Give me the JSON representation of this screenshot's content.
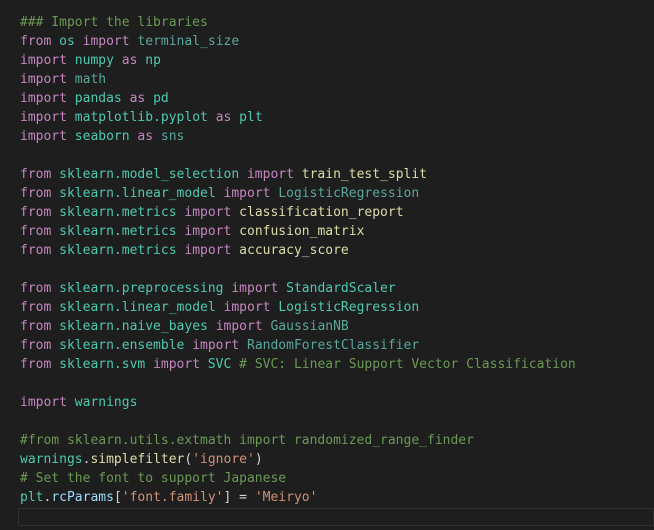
{
  "colors": {
    "background": "#1e1e1e",
    "keyword": "#c586c0",
    "module": "#4ec9b0",
    "dim_module": "#58a89b",
    "function": "#dcdcaa",
    "string": "#ce9178",
    "comment": "#6a9955",
    "variable": "#9cdcfe",
    "text": "#d4d4d4"
  },
  "lines": [
    [
      {
        "t": "### Import the libraries",
        "k": "comment"
      }
    ],
    [
      {
        "t": "from",
        "k": "keyword"
      },
      {
        "t": " ",
        "k": "plain"
      },
      {
        "t": "os",
        "k": "module"
      },
      {
        "t": " ",
        "k": "plain"
      },
      {
        "t": "import",
        "k": "keyword"
      },
      {
        "t": " ",
        "k": "plain"
      },
      {
        "t": "terminal_size",
        "k": "dim"
      }
    ],
    [
      {
        "t": "import",
        "k": "keyword"
      },
      {
        "t": " ",
        "k": "plain"
      },
      {
        "t": "numpy",
        "k": "module"
      },
      {
        "t": " ",
        "k": "plain"
      },
      {
        "t": "as",
        "k": "keyword"
      },
      {
        "t": " ",
        "k": "plain"
      },
      {
        "t": "np",
        "k": "module"
      }
    ],
    [
      {
        "t": "import",
        "k": "keyword"
      },
      {
        "t": " ",
        "k": "plain"
      },
      {
        "t": "math",
        "k": "dim"
      }
    ],
    [
      {
        "t": "import",
        "k": "keyword"
      },
      {
        "t": " ",
        "k": "plain"
      },
      {
        "t": "pandas",
        "k": "module"
      },
      {
        "t": " ",
        "k": "plain"
      },
      {
        "t": "as",
        "k": "keyword"
      },
      {
        "t": " ",
        "k": "plain"
      },
      {
        "t": "pd",
        "k": "module"
      }
    ],
    [
      {
        "t": "import",
        "k": "keyword"
      },
      {
        "t": " ",
        "k": "plain"
      },
      {
        "t": "matplotlib.pyplot",
        "k": "module"
      },
      {
        "t": " ",
        "k": "plain"
      },
      {
        "t": "as",
        "k": "keyword"
      },
      {
        "t": " ",
        "k": "plain"
      },
      {
        "t": "plt",
        "k": "module"
      }
    ],
    [
      {
        "t": "import",
        "k": "keyword"
      },
      {
        "t": " ",
        "k": "plain"
      },
      {
        "t": "seaborn",
        "k": "module"
      },
      {
        "t": " ",
        "k": "plain"
      },
      {
        "t": "as",
        "k": "keyword"
      },
      {
        "t": " ",
        "k": "plain"
      },
      {
        "t": "sns",
        "k": "dim"
      }
    ],
    [],
    [
      {
        "t": "from",
        "k": "keyword"
      },
      {
        "t": " ",
        "k": "plain"
      },
      {
        "t": "sklearn.model_selection",
        "k": "module"
      },
      {
        "t": " ",
        "k": "plain"
      },
      {
        "t": "import",
        "k": "keyword"
      },
      {
        "t": " ",
        "k": "plain"
      },
      {
        "t": "train_test_split",
        "k": "func"
      }
    ],
    [
      {
        "t": "from",
        "k": "keyword"
      },
      {
        "t": " ",
        "k": "plain"
      },
      {
        "t": "sklearn.linear_model",
        "k": "module"
      },
      {
        "t": " ",
        "k": "plain"
      },
      {
        "t": "import",
        "k": "keyword"
      },
      {
        "t": " ",
        "k": "plain"
      },
      {
        "t": "LogisticRegression",
        "k": "dim"
      }
    ],
    [
      {
        "t": "from",
        "k": "keyword"
      },
      {
        "t": " ",
        "k": "plain"
      },
      {
        "t": "sklearn.metrics",
        "k": "module"
      },
      {
        "t": " ",
        "k": "plain"
      },
      {
        "t": "import",
        "k": "keyword"
      },
      {
        "t": " ",
        "k": "plain"
      },
      {
        "t": "classification_report",
        "k": "func"
      }
    ],
    [
      {
        "t": "from",
        "k": "keyword"
      },
      {
        "t": " ",
        "k": "plain"
      },
      {
        "t": "sklearn.metrics",
        "k": "module"
      },
      {
        "t": " ",
        "k": "plain"
      },
      {
        "t": "import",
        "k": "keyword"
      },
      {
        "t": " ",
        "k": "plain"
      },
      {
        "t": "confusion_matrix",
        "k": "func"
      }
    ],
    [
      {
        "t": "from",
        "k": "keyword"
      },
      {
        "t": " ",
        "k": "plain"
      },
      {
        "t": "sklearn.metrics",
        "k": "module"
      },
      {
        "t": " ",
        "k": "plain"
      },
      {
        "t": "import",
        "k": "keyword"
      },
      {
        "t": " ",
        "k": "plain"
      },
      {
        "t": "accuracy_score",
        "k": "func"
      }
    ],
    [],
    [
      {
        "t": "from",
        "k": "keyword"
      },
      {
        "t": " ",
        "k": "plain"
      },
      {
        "t": "sklearn.preprocessing",
        "k": "module"
      },
      {
        "t": " ",
        "k": "plain"
      },
      {
        "t": "import",
        "k": "keyword"
      },
      {
        "t": " ",
        "k": "plain"
      },
      {
        "t": "StandardScaler",
        "k": "module"
      }
    ],
    [
      {
        "t": "from",
        "k": "keyword"
      },
      {
        "t": " ",
        "k": "plain"
      },
      {
        "t": "sklearn.linear_model",
        "k": "module"
      },
      {
        "t": " ",
        "k": "plain"
      },
      {
        "t": "import",
        "k": "keyword"
      },
      {
        "t": " ",
        "k": "plain"
      },
      {
        "t": "LogisticRegression",
        "k": "module"
      }
    ],
    [
      {
        "t": "from",
        "k": "keyword"
      },
      {
        "t": " ",
        "k": "plain"
      },
      {
        "t": "sklearn.naive_bayes",
        "k": "module"
      },
      {
        "t": " ",
        "k": "plain"
      },
      {
        "t": "import",
        "k": "keyword"
      },
      {
        "t": " ",
        "k": "plain"
      },
      {
        "t": "GaussianNB",
        "k": "dim"
      }
    ],
    [
      {
        "t": "from",
        "k": "keyword"
      },
      {
        "t": " ",
        "k": "plain"
      },
      {
        "t": "sklearn.ensemble",
        "k": "module"
      },
      {
        "t": " ",
        "k": "plain"
      },
      {
        "t": "import",
        "k": "keyword"
      },
      {
        "t": " ",
        "k": "plain"
      },
      {
        "t": "RandomForestClassifier",
        "k": "dim"
      }
    ],
    [
      {
        "t": "from",
        "k": "keyword"
      },
      {
        "t": " ",
        "k": "plain"
      },
      {
        "t": "sklearn.svm",
        "k": "module"
      },
      {
        "t": " ",
        "k": "plain"
      },
      {
        "t": "import",
        "k": "keyword"
      },
      {
        "t": " ",
        "k": "plain"
      },
      {
        "t": "SVC",
        "k": "module"
      },
      {
        "t": " ",
        "k": "plain"
      },
      {
        "t": "# SVC: Linear Support Vector Classification",
        "k": "comment"
      }
    ],
    [],
    [
      {
        "t": "import",
        "k": "keyword"
      },
      {
        "t": " ",
        "k": "plain"
      },
      {
        "t": "warnings",
        "k": "module"
      }
    ],
    [],
    [
      {
        "t": "#from sklearn.utils.extmath import randomized_range_finder",
        "k": "comment"
      }
    ],
    [
      {
        "t": "warnings",
        "k": "module"
      },
      {
        "t": ".",
        "k": "plain"
      },
      {
        "t": "simplefilter",
        "k": "func"
      },
      {
        "t": "(",
        "k": "plain"
      },
      {
        "t": "'ignore'",
        "k": "string"
      },
      {
        "t": ")",
        "k": "plain"
      }
    ],
    [
      {
        "t": "# Set the font to support Japanese",
        "k": "comment"
      }
    ],
    [
      {
        "t": "plt",
        "k": "module"
      },
      {
        "t": ".",
        "k": "plain"
      },
      {
        "t": "rcParams",
        "k": "var"
      },
      {
        "t": "[",
        "k": "plain"
      },
      {
        "t": "'font.family'",
        "k": "string"
      },
      {
        "t": "] = ",
        "k": "plain"
      },
      {
        "t": "'Meiryo'",
        "k": "string"
      }
    ]
  ]
}
